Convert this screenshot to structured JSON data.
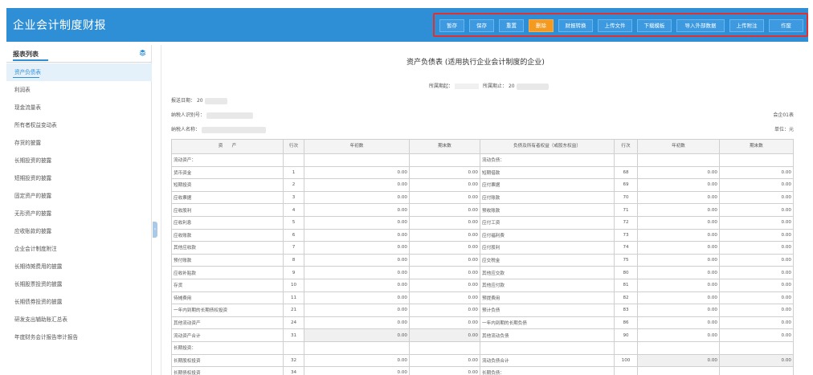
{
  "app": {
    "title": "企业会计制度财报"
  },
  "toolbar": {
    "buttons": [
      "暂存",
      "保存",
      "重置",
      "删除",
      "财报转换",
      "上传文件",
      "下载模板",
      "导入外部数据",
      "上传附注",
      "作废"
    ],
    "active_index": 3
  },
  "sidebar": {
    "title": "报表列表",
    "items": [
      "资产负债表",
      "利润表",
      "现金流量表",
      "所有者权益变动表",
      "存货的披露",
      "长期投资的披露",
      "短期投资的披露",
      "固定资产的披露",
      "无形资产的披露",
      "应收账款的披露",
      "企业会计制度附注",
      "长期待摊费用的披露",
      "长期股票投资的披露",
      "长期债券投资的披露",
      "研发支出辅助账汇总表",
      "年度财务会计报告审计报告"
    ],
    "active_index": 0
  },
  "doc": {
    "title": "资产负债表 (适用执行企业会计制度的企业)",
    "period_start_label": "所属期起：",
    "period_end_label": "所属期止：",
    "period_end_value": "20",
    "report_date_label": "报送日期：",
    "report_date_value": "20",
    "taxpayer_id_label": "纳税人识别号：",
    "taxpayer_name_label": "纳税人名称：",
    "form_code": "会企01表",
    "unit": "单位：元"
  },
  "table": {
    "headers": [
      "资　　产",
      "行次",
      "年初数",
      "期末数",
      "负债及所有者权益（或股东权益）",
      "行次",
      "年初数",
      "期末数"
    ],
    "rows": [
      [
        "流动资产：",
        "",
        "",
        "",
        "流动负债：",
        "",
        "",
        ""
      ],
      [
        "货币资金",
        "1",
        "0.00",
        "0.00",
        "短期借款",
        "68",
        "0.00",
        "0.00"
      ],
      [
        "短期投资",
        "2",
        "0.00",
        "0.00",
        "应付票据",
        "69",
        "0.00",
        "0.00"
      ],
      [
        "应收票据",
        "3",
        "0.00",
        "0.00",
        "应付账款",
        "70",
        "0.00",
        "0.00"
      ],
      [
        "应收股利",
        "4",
        "0.00",
        "0.00",
        "预收账款",
        "71",
        "0.00",
        "0.00"
      ],
      [
        "应收利息",
        "5",
        "0.00",
        "0.00",
        "应付工资",
        "72",
        "0.00",
        "0.00"
      ],
      [
        "应收账款",
        "6",
        "0.00",
        "0.00",
        "应付福利费",
        "73",
        "0.00",
        "0.00"
      ],
      [
        "其他应收款",
        "7",
        "0.00",
        "0.00",
        "应付股利",
        "74",
        "0.00",
        "0.00"
      ],
      [
        "预付账款",
        "8",
        "0.00",
        "0.00",
        "应交税金",
        "75",
        "0.00",
        "0.00"
      ],
      [
        "应收补贴款",
        "9",
        "0.00",
        "0.00",
        "其他应交款",
        "80",
        "0.00",
        "0.00"
      ],
      [
        "存货",
        "10",
        "0.00",
        "0.00",
        "其他应付款",
        "81",
        "0.00",
        "0.00"
      ],
      [
        "待摊费用",
        "11",
        "0.00",
        "0.00",
        "预提费用",
        "82",
        "0.00",
        "0.00"
      ],
      [
        "一年内到期的长期债权投资",
        "21",
        "0.00",
        "0.00",
        "预计负债",
        "83",
        "0.00",
        "0.00"
      ],
      [
        "其他流动资产",
        "24",
        "0.00",
        "0.00",
        "一年内到期的长期负债",
        "86",
        "0.00",
        "0.00"
      ],
      [
        "流动资产合计",
        "31",
        "0.00",
        "0.00",
        "其他流动负债",
        "90",
        "0.00",
        "0.00"
      ],
      [
        "长期投资：",
        "",
        "",
        "",
        "",
        "",
        "",
        ""
      ],
      [
        "长期股权投资",
        "32",
        "0.00",
        "0.00",
        "流动负债合计",
        "100",
        "0.00",
        "0.00"
      ],
      [
        "长期债权投资",
        "34",
        "0.00",
        "0.00",
        "长期负债：",
        "",
        "",
        ""
      ]
    ]
  }
}
